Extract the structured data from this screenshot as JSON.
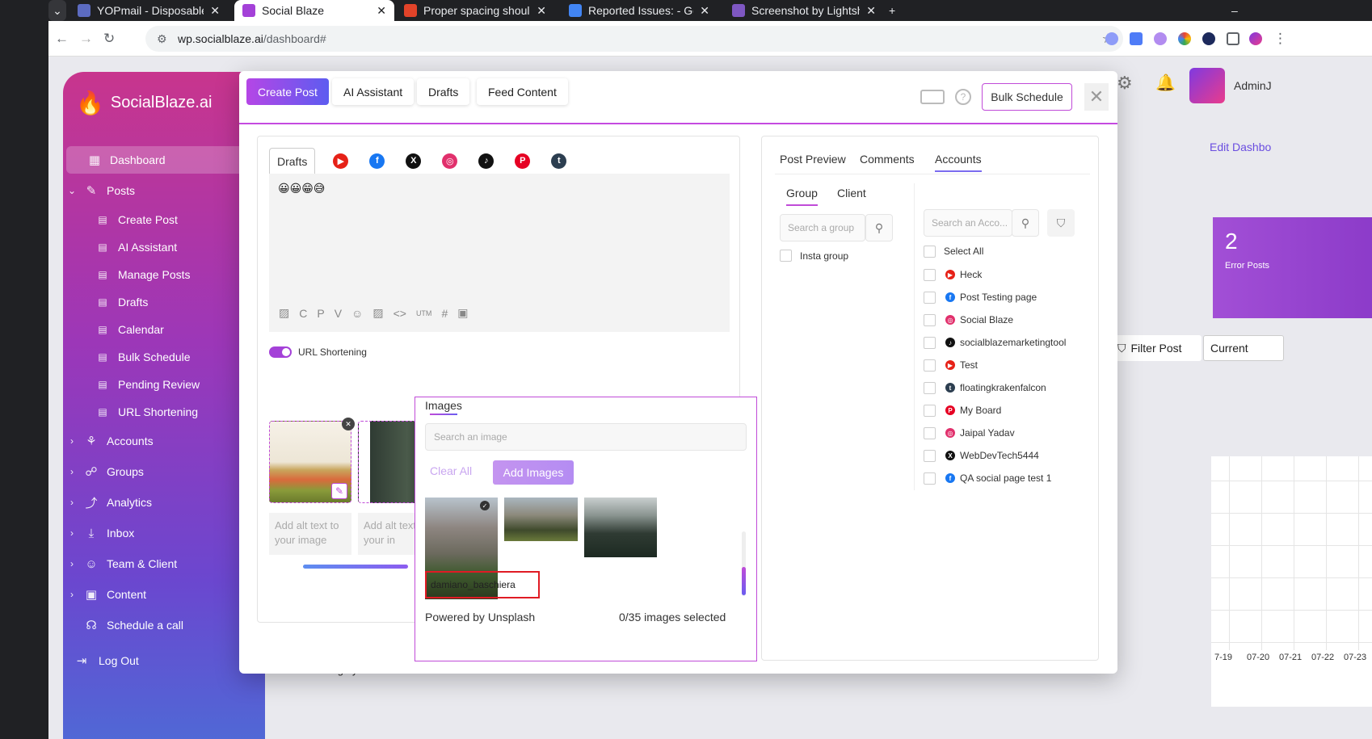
{
  "browser": {
    "tabs": [
      {
        "title": "YOPmail - Disposable Em",
        "color": "#5c6bc0"
      },
      {
        "title": "Social Blaze",
        "color": "#a441d8"
      },
      {
        "title": "Proper spacing should b",
        "color": "#e24329"
      },
      {
        "title": "Reported Issues: - Googl",
        "color": "#4285f4"
      },
      {
        "title": "Screenshot by Lightshot",
        "color": "#7e57c2"
      }
    ],
    "url_domain": "wp.socialblaze.ai",
    "url_path": "/dashboard#",
    "close_glyph": "✕",
    "new_tab_glyph": "+"
  },
  "sidebar": {
    "brand": "SocialBlaze.ai",
    "items": [
      {
        "label": "Dashboard",
        "icon": "dashboard-icon",
        "glyph": "▦",
        "chev": ""
      },
      {
        "label": "Posts",
        "icon": "posts-icon",
        "glyph": "✎",
        "chev": "⌄"
      },
      {
        "label": "Create Post",
        "icon": "create-post-icon",
        "glyph": "▤",
        "chev": ""
      },
      {
        "label": "AI Assistant",
        "icon": "ai-assistant-icon",
        "glyph": "▤",
        "chev": ""
      },
      {
        "label": "Manage Posts",
        "icon": "manage-posts-icon",
        "glyph": "▤",
        "chev": ""
      },
      {
        "label": "Drafts",
        "icon": "drafts-icon",
        "glyph": "▤",
        "chev": ""
      },
      {
        "label": "Calendar",
        "icon": "calendar-icon",
        "glyph": "▤",
        "chev": ""
      },
      {
        "label": "Bulk Schedule",
        "icon": "bulk-schedule-icon",
        "glyph": "▤",
        "chev": ""
      },
      {
        "label": "Pending Review",
        "icon": "pending-review-icon",
        "glyph": "▤",
        "chev": ""
      },
      {
        "label": "URL Shortening",
        "icon": "url-shortening-icon",
        "glyph": "▤",
        "chev": ""
      },
      {
        "label": "Accounts",
        "icon": "accounts-icon",
        "glyph": "⚘",
        "chev": "›"
      },
      {
        "label": "Groups",
        "icon": "groups-icon",
        "glyph": "☍",
        "chev": "›"
      },
      {
        "label": "Analytics",
        "icon": "analytics-icon",
        "glyph": "⤴",
        "chev": "›"
      },
      {
        "label": "Inbox",
        "icon": "inbox-icon",
        "glyph": "⤓",
        "chev": "›"
      },
      {
        "label": "Team & Client",
        "icon": "team-icon",
        "glyph": "☺",
        "chev": "›"
      },
      {
        "label": "Content",
        "icon": "content-icon",
        "glyph": "▣",
        "chev": "›"
      },
      {
        "label": "Schedule a call",
        "icon": "headset-icon",
        "glyph": "☊",
        "chev": ""
      }
    ],
    "logout": "Log Out"
  },
  "background": {
    "user": "AdminJ",
    "edit_dashboard": "Edit Dashbo",
    "stat_value": "2",
    "stat_label": "Error Posts",
    "filter_post": "Filter Post",
    "current": "Current",
    "dates": [
      "7-19",
      "07-20",
      "07-21",
      "07-22",
      "07-23"
    ],
    "bottom_text": "Publishing by Accounts"
  },
  "modal": {
    "tabs": [
      "Create Post",
      "AI Assistant",
      "Drafts",
      "Feed Content"
    ],
    "bulk_schedule": "Bulk Schedule",
    "help_glyph": "?",
    "close_glyph": "✕",
    "editor": {
      "drafts_tab": "Drafts",
      "platforms": [
        {
          "name": "youtube-icon",
          "color": "#e62117",
          "glyph": "▶"
        },
        {
          "name": "facebook-icon",
          "color": "#1877f2",
          "glyph": "f"
        },
        {
          "name": "x-icon",
          "color": "#111111",
          "glyph": "X"
        },
        {
          "name": "instagram-icon",
          "color": "#e1306c",
          "glyph": "◎"
        },
        {
          "name": "tiktok-icon",
          "color": "#111111",
          "glyph": "♪"
        },
        {
          "name": "pinterest-icon",
          "color": "#e60023",
          "glyph": "P"
        },
        {
          "name": "tumblr-icon",
          "color": "#2c3e50",
          "glyph": "t"
        }
      ],
      "post_text": "😀😀😁😅",
      "toolbar_icons": [
        {
          "name": "image-icon",
          "glyph": "▨"
        },
        {
          "name": "canva-icon",
          "glyph": "C"
        },
        {
          "name": "picsart-icon",
          "glyph": "P"
        },
        {
          "name": "vista-icon",
          "glyph": "V"
        },
        {
          "name": "emoji-icon",
          "glyph": "☺"
        },
        {
          "name": "gallery-icon",
          "glyph": "▨"
        },
        {
          "name": "code-icon",
          "glyph": "<>"
        },
        {
          "name": "utm-icon",
          "glyph": "UTM"
        },
        {
          "name": "hashtag-icon",
          "glyph": "#"
        },
        {
          "name": "add-media-icon",
          "glyph": "▣"
        }
      ],
      "url_shortening": "URL Shortening",
      "alt_placeholder": "Add alt text to your image",
      "alt_placeholder_short": "Add alt text to your in",
      "remove_glyph": "✕",
      "edit_glyph": "✎"
    },
    "images_popup": {
      "title": "Images",
      "search_placeholder": "Search an image",
      "clear_all": "Clear All",
      "add_images": "Add Images",
      "credit": "damiano_baschiera",
      "check_glyph": "✓",
      "powered_by": "Powered by Unsplash",
      "selected_count": "0/35 images selected"
    },
    "right": {
      "tabs": [
        "Post Preview",
        "Comments",
        "Accounts"
      ],
      "subtabs": [
        "Group",
        "Client"
      ],
      "group_search": "Search a group",
      "account_search": "Search an Acco...",
      "groups": [
        "Insta group"
      ],
      "select_all": "Select All",
      "accounts": [
        {
          "name": "Heck",
          "platform": "youtube-icon",
          "color": "#e62117",
          "glyph": "▶"
        },
        {
          "name": "Post Testing page",
          "platform": "facebook-icon",
          "color": "#1877f2",
          "glyph": "f"
        },
        {
          "name": "Social Blaze",
          "platform": "instagram-icon",
          "color": "#e1306c",
          "glyph": "◎"
        },
        {
          "name": "socialblazemarketingtool",
          "platform": "tiktok-icon",
          "color": "#111111",
          "glyph": "♪"
        },
        {
          "name": "Test",
          "platform": "youtube-icon",
          "color": "#e62117",
          "glyph": "▶"
        },
        {
          "name": "floatingkrakenfalcon",
          "platform": "tumblr-icon",
          "color": "#2c3e50",
          "glyph": "t"
        },
        {
          "name": "My Board",
          "platform": "pinterest-icon",
          "color": "#e60023",
          "glyph": "P"
        },
        {
          "name": "Jaipal Yadav",
          "platform": "instagram-icon",
          "color": "#e1306c",
          "glyph": "◎"
        },
        {
          "name": "WebDevTech5444",
          "platform": "x-icon",
          "color": "#111111",
          "glyph": "X"
        },
        {
          "name": "QA social page test 1",
          "platform": "facebook-icon",
          "color": "#1877f2",
          "glyph": "f"
        }
      ]
    }
  }
}
